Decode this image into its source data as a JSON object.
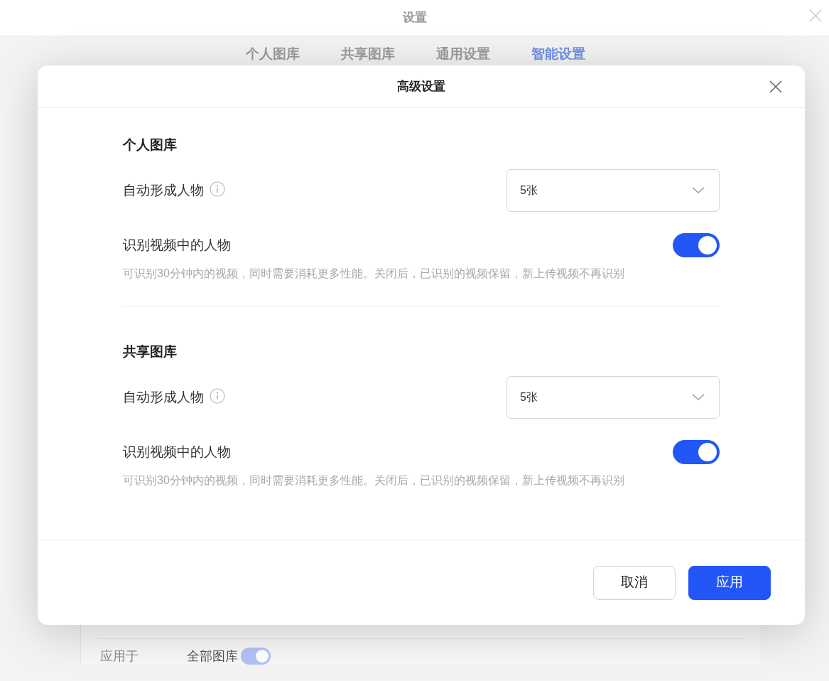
{
  "window": {
    "title": "设置"
  },
  "tabs": [
    {
      "label": "个人图库",
      "selected": false
    },
    {
      "label": "共享图库",
      "selected": false
    },
    {
      "label": "通用设置",
      "selected": false
    },
    {
      "label": "智能设置",
      "selected": true
    }
  ],
  "background_row": {
    "label": "应用于",
    "value": "全部图库",
    "on": true
  },
  "dialog": {
    "title": "高级设置",
    "sections": [
      {
        "title": "个人图库",
        "auto_person": {
          "label": "自动形成人物",
          "value": "5张"
        },
        "video_recognition": {
          "label": "识别视频中的人物",
          "on": true,
          "description": "可识别30分钟内的视频，同时需要消耗更多性能。关闭后，已识别的视频保留，新上传视频不再识别"
        }
      },
      {
        "title": "共享图库",
        "auto_person": {
          "label": "自动形成人物",
          "value": "5张"
        },
        "video_recognition": {
          "label": "识别视频中的人物",
          "on": true,
          "description": "可识别30分钟内的视频，同时需要消耗更多性能。关闭后，已识别的视频保留，新上传视频不再识别"
        }
      }
    ],
    "buttons": [
      {
        "label": "取消",
        "kind": "secondary"
      },
      {
        "label": "应用",
        "kind": "primary"
      }
    ]
  }
}
